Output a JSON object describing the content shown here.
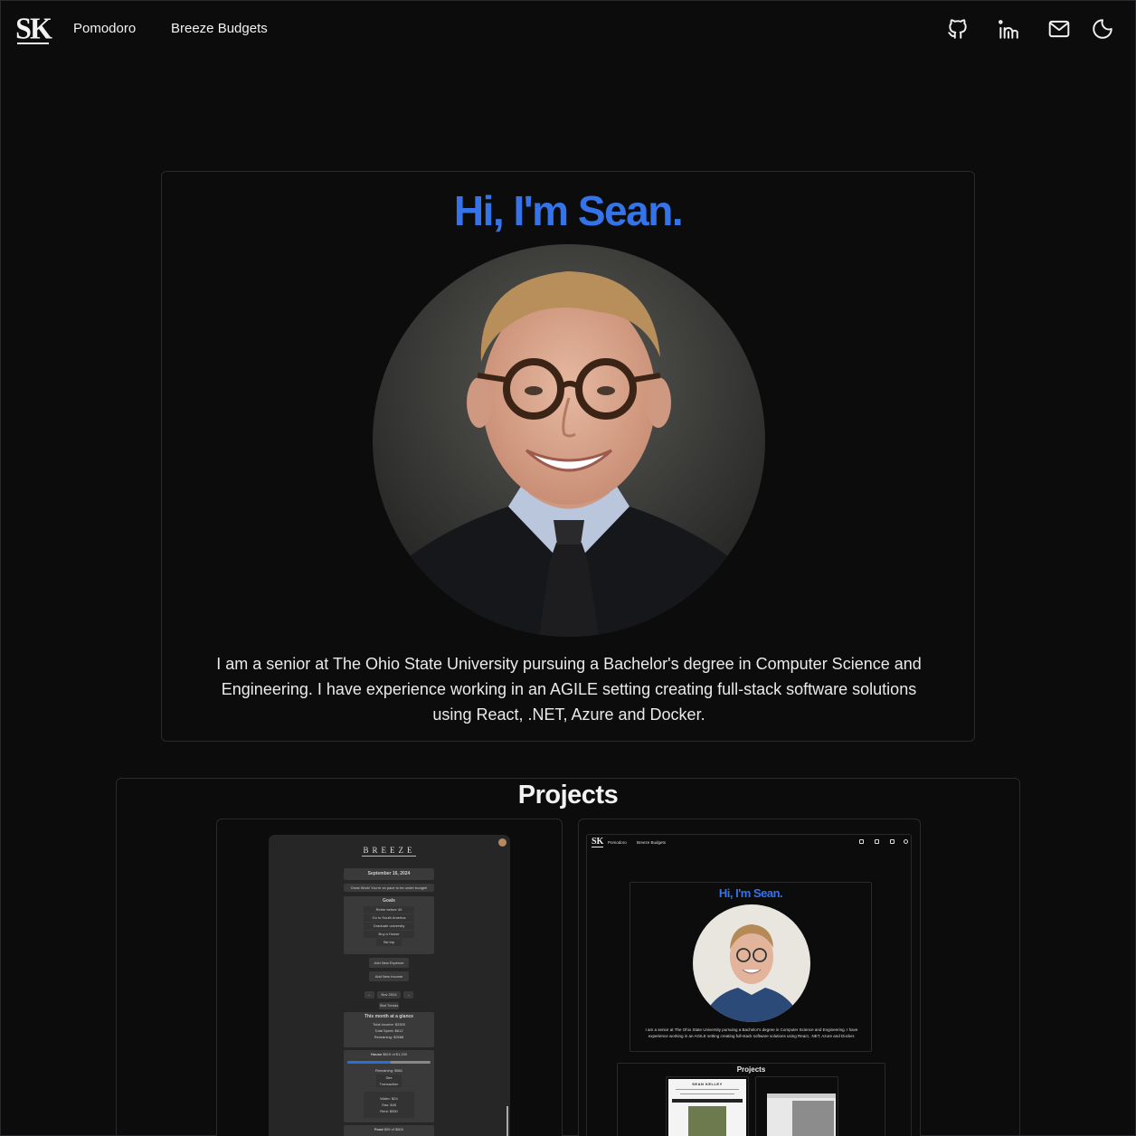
{
  "nav": {
    "logo_text": "SK",
    "links": [
      "Pomodoro",
      "Breeze Budgets"
    ],
    "icons": [
      "github-icon",
      "linkedin-icon",
      "mail-icon",
      "moon-icon"
    ]
  },
  "hero": {
    "title": "Hi, I'm Sean.",
    "bio": "I am a senior at The Ohio State University pursuing a Bachelor's degree in Computer Science and Engineering. I have experience working in an AGILE setting creating full-stack software solutions using React, .NET, Azure and Docker."
  },
  "projects": {
    "title": "Projects",
    "breeze_preview": {
      "brand": "BREEZE",
      "date": "September 16, 2024",
      "tagline": "Great Work! You're on pace to be under budget!",
      "goals_title": "Goals",
      "goals": [
        "Retire before 40",
        "Go to South America",
        "Graduate university",
        "Buy a House",
        "Ski trip"
      ],
      "add_expense": "Add New Expense",
      "add_income": "Add New Income",
      "month": "Nov 2024",
      "stats_button": "Stat Trends",
      "glance_title": "This month at a glance",
      "glance_lines": [
        "Total Income: $3300",
        "Total Spent: $612",
        "Remaining: $2688"
      ],
      "house_label": "House",
      "house_amount": "$619 of $1,200",
      "house_progress": 0.52,
      "house_remaining": "Remaining: $581",
      "house_button": "See Transaction",
      "house_items": [
        "Water: $24",
        "Gas: $45",
        "Rent: $550"
      ],
      "food_label": "Food",
      "food_amount": "$95 of $500",
      "food_progress": 0.19
    },
    "site_preview": {
      "logo": "SK",
      "nav": [
        "Pomodoro",
        "Breeze Budgets"
      ],
      "title": "Hi, I'm Sean.",
      "bio": "I am a senior at The Ohio State University pursuing a Bachelor's degree in Computer Science and Engineering. I have experience working in an AGILE setting creating full-stack software solutions using React, .NET, Azure and Docker.",
      "projects_title": "Projects",
      "resume_name": "SEAN KELLEY"
    }
  },
  "colors": {
    "background": "#0c0c0d",
    "accent": "#3574e8",
    "border": "#2a2a2c"
  }
}
